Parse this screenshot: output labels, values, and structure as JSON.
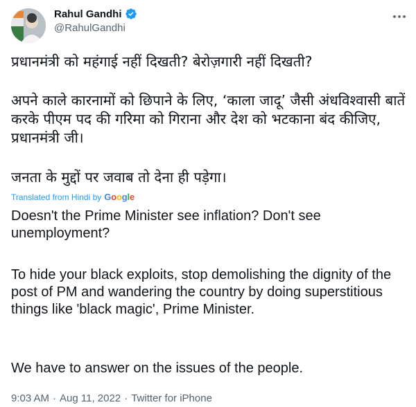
{
  "author": {
    "name": "Rahul Gandhi",
    "handle": "@RahulGandhi",
    "verified": true,
    "accent_color": "#1d9bf0"
  },
  "tweet": {
    "hindi_paragraphs": [
      "प्रधानमंत्री को महंगाई नहीं दिखती? बेरोज़गारी नहीं दिखती?",
      "अपने काले कारनामों को छिपाने के लिए, ‘काला जादू’ जैसी अंधविश्वासी बातें करके पीएम पद की गरिमा को गिराना और देश को भटकाना बंद कीजिए, प्रधानमंत्री जी।",
      "जनता के मुद्दों पर जवाब तो देना ही पड़ेगा।"
    ],
    "translated_label": "Translated from Hindi by",
    "translator_logo": "Google",
    "english_paragraphs": [
      "Doesn't the Prime Minister see inflation? Don't see unemployment?",
      " To hide your black exploits, stop demolishing the dignity of the post of PM and wandering the country by doing superstitious things like 'black magic', Prime Minister.",
      " We have to answer on the issues of the people."
    ]
  },
  "meta": {
    "time": "9:03 AM",
    "date": "Aug 11, 2022",
    "source": "Twitter for iPhone",
    "separator": "·"
  },
  "icons": {
    "verified": "verified-badge-icon",
    "more": "more-options-icon"
  }
}
